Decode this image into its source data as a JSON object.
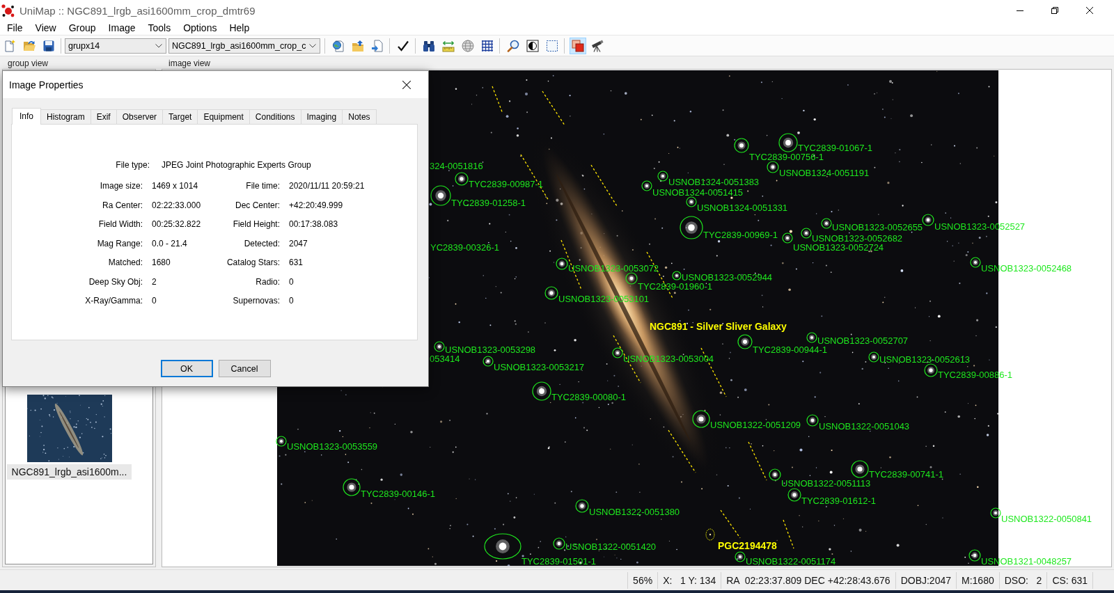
{
  "window": {
    "title": "UniMap :: NGC891_lrgb_asi1600mm_crop_dmtr69"
  },
  "menu": [
    "File",
    "View",
    "Group",
    "Image",
    "Tools",
    "Options",
    "Help"
  ],
  "toolbar": {
    "group_select": "grupx14",
    "image_select": "NGC891_lrgb_asi1600mm_crop_c",
    "toggle": {
      "pressed": true
    }
  },
  "panels": {
    "group_view": {
      "title": "group view",
      "items": [
        {
          "label": "NGC891_lrgb_asi1600m...",
          "selected": true
        }
      ]
    },
    "image_view": {
      "title": "image view",
      "annotations": [
        {
          "kind": "star",
          "label": "TYC2839-01067-1"
        },
        {
          "kind": "star",
          "label": "TYC2839-00756-1"
        },
        {
          "kind": "star",
          "label": "324-0051816"
        },
        {
          "kind": "star",
          "label": "USNOB1324-0051191"
        },
        {
          "kind": "star",
          "label": "TYC2839-00987-1"
        },
        {
          "kind": "star",
          "label": "USNOB1324-0051383"
        },
        {
          "kind": "star",
          "label": "USNOB1324-0051415"
        },
        {
          "kind": "star",
          "label": "TYC2839-01258-1"
        },
        {
          "kind": "star",
          "label": "USNOB1324-0051331"
        },
        {
          "kind": "star",
          "label": "USNOB1323-0052655"
        },
        {
          "kind": "star",
          "label": "USNOB1323-0052527"
        },
        {
          "kind": "star",
          "label": "TYC2839-00969-1"
        },
        {
          "kind": "star",
          "label": "USNOB1323-0052682"
        },
        {
          "kind": "star",
          "label": "YC2839-00326-1"
        },
        {
          "kind": "star",
          "label": "USNOB1323-0052724"
        },
        {
          "kind": "star",
          "label": "USNOB1323-0053072"
        },
        {
          "kind": "star",
          "label": "USNOB1323-0052468"
        },
        {
          "kind": "star",
          "label": "USNOB1323-0052944"
        },
        {
          "kind": "star",
          "label": "TYC2839-01960-1"
        },
        {
          "kind": "star",
          "label": "USNOB1323-0053101"
        },
        {
          "kind": "galaxy",
          "label": "NGC891 - Silver Sliver Galaxy"
        },
        {
          "kind": "star",
          "label": "USNOB1323-0052707"
        },
        {
          "kind": "star",
          "label": "USNOB1323-0053298"
        },
        {
          "kind": "star",
          "label": "TYC2839-00944-1"
        },
        {
          "kind": "star",
          "label": "053414"
        },
        {
          "kind": "star",
          "label": "USNOB1323-0053004"
        },
        {
          "kind": "star",
          "label": "USNOB1323-0052613"
        },
        {
          "kind": "star",
          "label": "USNOB1323-0053217"
        },
        {
          "kind": "star",
          "label": "TYC2839-00886-1"
        },
        {
          "kind": "star",
          "label": "TYC2839-00080-1"
        },
        {
          "kind": "star",
          "label": "USNOB1322-0051209"
        },
        {
          "kind": "star",
          "label": "USNOB1322-0051043"
        },
        {
          "kind": "star",
          "label": "USNOB1323-0053559"
        },
        {
          "kind": "star",
          "label": "TYC2839-00741-1"
        },
        {
          "kind": "star",
          "label": "USNOB1322-0051113"
        },
        {
          "kind": "star",
          "label": "TYC2839-00146-1"
        },
        {
          "kind": "star",
          "label": "TYC2839-01612-1"
        },
        {
          "kind": "star",
          "label": "USNOB1322-0051380"
        },
        {
          "kind": "star",
          "label": "USNOB1322-0050841"
        },
        {
          "kind": "star",
          "label": "USNOB1322-0051420"
        },
        {
          "kind": "galaxy",
          "label": "PGC2194478"
        },
        {
          "kind": "star",
          "label": "TYC2839-01501-1"
        },
        {
          "kind": "star",
          "label": "USNOB1322-0051174"
        },
        {
          "kind": "star",
          "label": "USNOB1321-0048257"
        }
      ]
    }
  },
  "dialog": {
    "title": "Image Properties",
    "tabs": [
      {
        "label": "Info",
        "selected": true
      },
      {
        "label": "Histogram",
        "selected": false
      },
      {
        "label": "Exif",
        "selected": false
      },
      {
        "label": "Observer",
        "selected": false
      },
      {
        "label": "Target",
        "selected": false
      },
      {
        "label": "Equipment",
        "selected": false
      },
      {
        "label": "Conditions",
        "selected": false
      },
      {
        "label": "Imaging",
        "selected": false
      },
      {
        "label": "Notes",
        "selected": false
      }
    ],
    "info": {
      "file_type": {
        "label": "File type:",
        "value": "JPEG Joint Photographic Experts Group"
      },
      "rows": [
        {
          "left": {
            "label": "Image size:",
            "value": "1469 x 1014"
          },
          "right": {
            "label": "File time:",
            "value": "2020/11/11 20:59:21"
          }
        },
        {
          "left": {
            "label": "Ra Center:",
            "value": "02:22:33.000"
          },
          "right": {
            "label": "Dec Center:",
            "value": "+42:20:49.999"
          }
        },
        {
          "left": {
            "label": "Field Width:",
            "value": "00:25:32.822"
          },
          "right": {
            "label": "Field Height:",
            "value": "00:17:38.083"
          }
        },
        {
          "left": {
            "label": "Mag Range:",
            "value": "0.0 - 21.4"
          },
          "right": {
            "label": "Detected:",
            "value": "2047"
          }
        },
        {
          "left": {
            "label": "Matched:",
            "value": "1680"
          },
          "right": {
            "label": "Catalog Stars:",
            "value": "631"
          }
        },
        {
          "left": {
            "label": "Deep Sky Obj:",
            "value": "2"
          },
          "right": {
            "label": "Radio:",
            "value": "0"
          }
        },
        {
          "left": {
            "label": "X-Ray/Gamma:",
            "value": "0"
          },
          "right": {
            "label": "Supernovas:",
            "value": "0"
          }
        }
      ]
    },
    "buttons": [
      {
        "label": "OK",
        "default": true
      },
      {
        "label": "Cancel",
        "default": false
      }
    ]
  },
  "status_bar": [
    "56%",
    "X:   1 Y: 134",
    "RA  02:23:37.809 DEC +42:28:43.676",
    "DOBJ:2047",
    "M:1680",
    "DSO:   2",
    "CS: 631"
  ]
}
